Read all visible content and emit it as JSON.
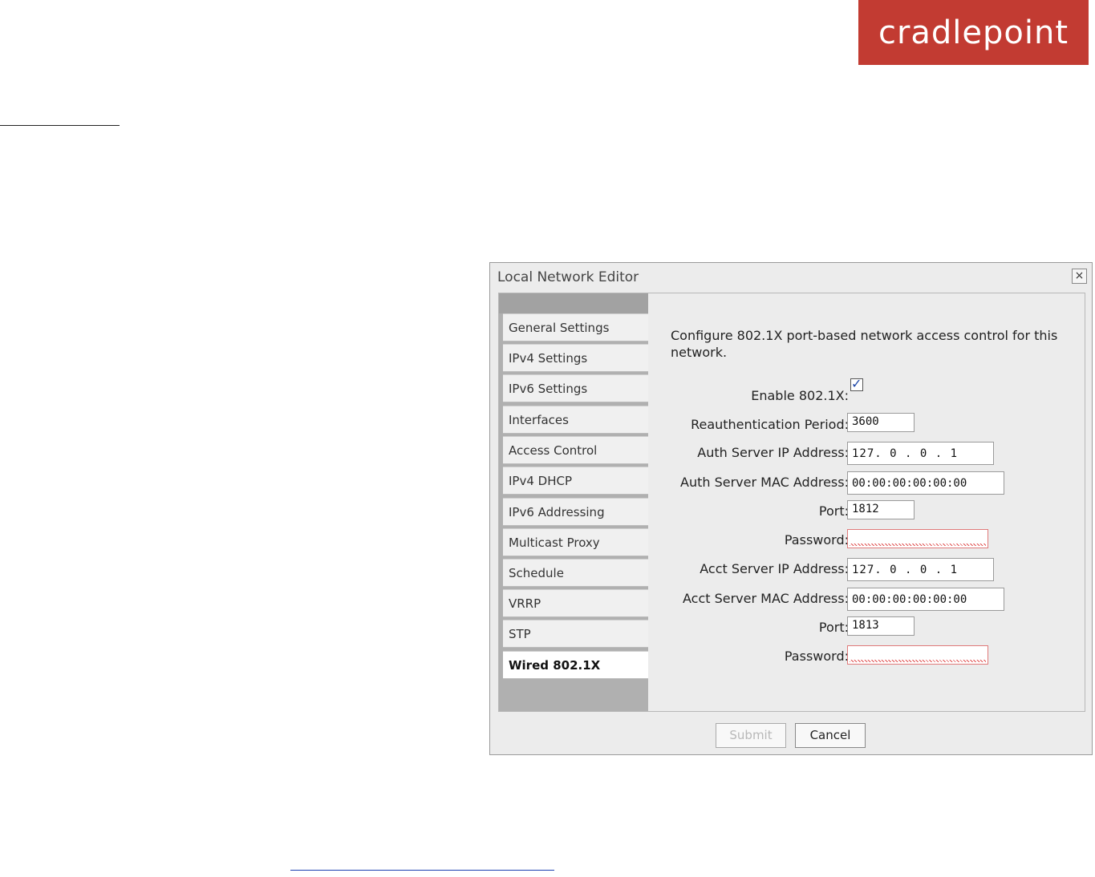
{
  "logo": {
    "text": "cradlepoint",
    "color": "#c23b32"
  },
  "dialog": {
    "title": "Local Network Editor",
    "close_icon": "×",
    "tabs": [
      {
        "label": "General Settings"
      },
      {
        "label": "IPv4 Settings"
      },
      {
        "label": "IPv6 Settings"
      },
      {
        "label": "Interfaces"
      },
      {
        "label": "Access Control"
      },
      {
        "label": "IPv4 DHCP"
      },
      {
        "label": "IPv6 Addressing"
      },
      {
        "label": "Multicast Proxy"
      },
      {
        "label": "Schedule"
      },
      {
        "label": "VRRP"
      },
      {
        "label": "STP"
      },
      {
        "label": "Wired 802.1X",
        "active": true
      }
    ],
    "description": "Configure 802.1X port-based network access control for this network.",
    "fields": {
      "enable_label": "Enable 802.1X:",
      "enable_checked": true,
      "reauth_label": "Reauthentication Period:",
      "reauth_value": "3600",
      "auth_ip_label": "Auth Server IP Address:",
      "auth_ip_value": "127. 0 . 0 . 1",
      "auth_mac_label": "Auth Server MAC Address:",
      "auth_mac_value": "00:00:00:00:00:00",
      "auth_port_label": "Port:",
      "auth_port_value": "1812",
      "auth_password_label": "Password:",
      "acct_ip_label": "Acct Server IP Address:",
      "acct_ip_value": "127. 0 . 0 . 1",
      "acct_mac_label": "Acct Server MAC Address:",
      "acct_mac_value": "00:00:00:00:00:00",
      "acct_port_label": "Port:",
      "acct_port_value": "1813",
      "acct_password_label": "Password:"
    },
    "buttons": {
      "submit": "Submit",
      "cancel": "Cancel"
    }
  }
}
